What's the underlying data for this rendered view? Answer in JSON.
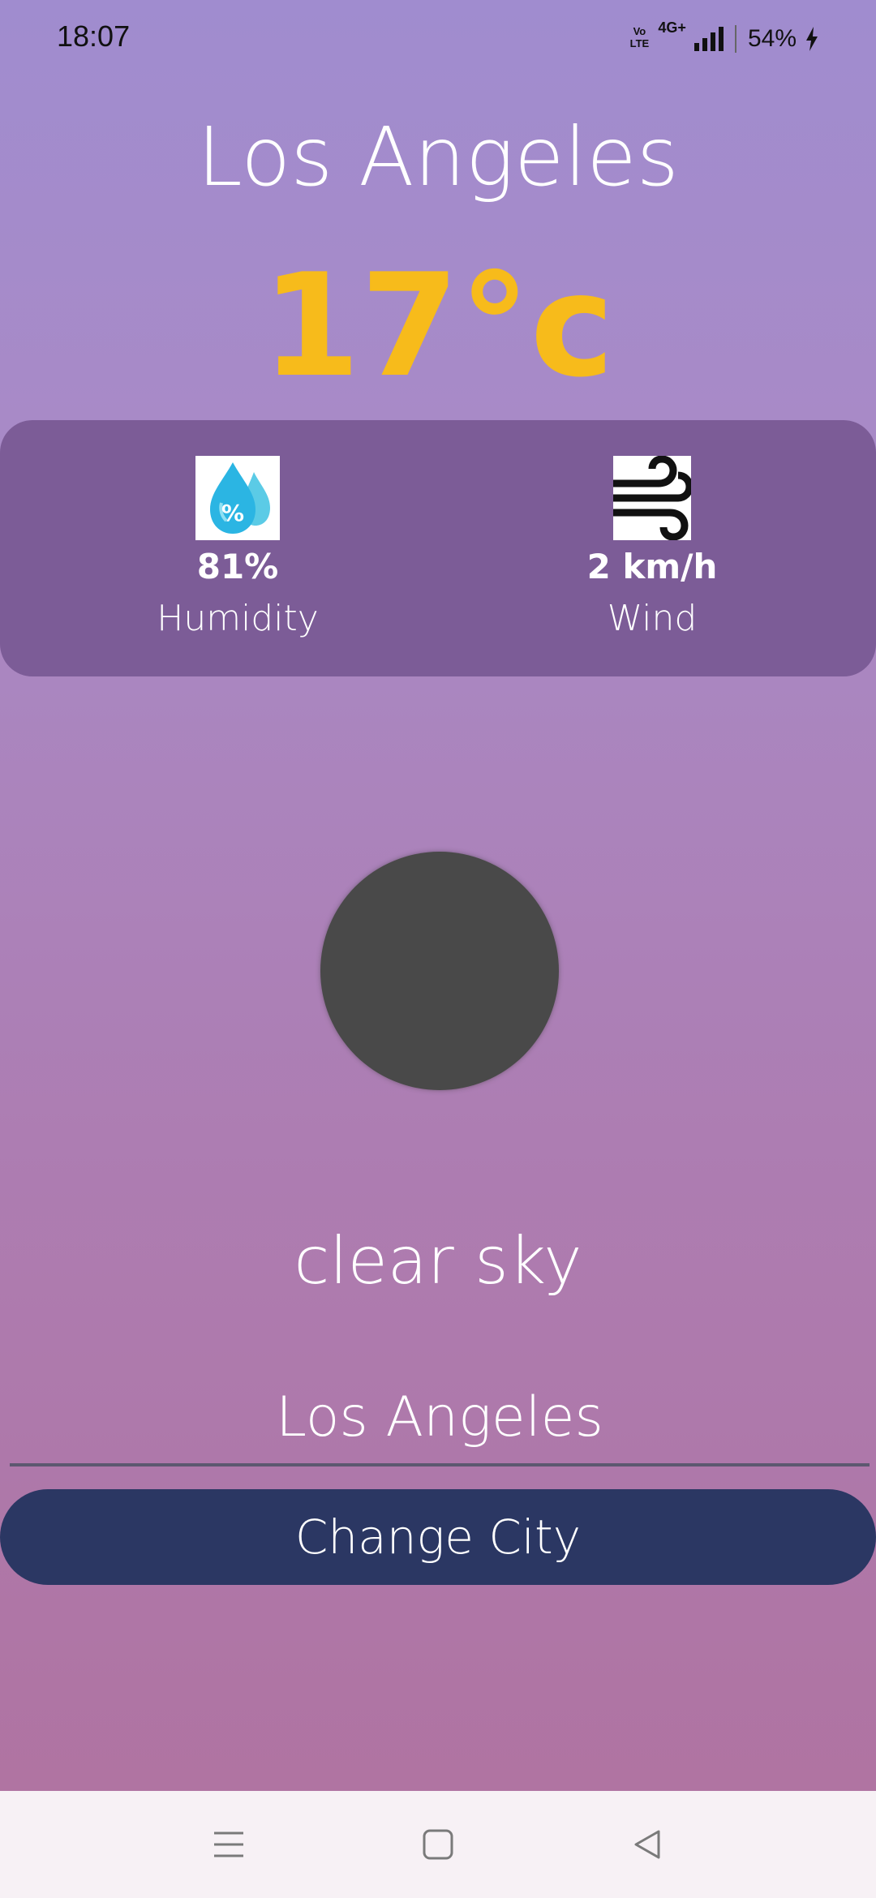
{
  "status_bar": {
    "time": "18:07",
    "network": "4G+",
    "battery": "54%"
  },
  "weather": {
    "city": "Los Angeles",
    "temperature": "17°c",
    "humidity_value": "81%",
    "humidity_label": "Humidity",
    "wind_value": "2 km/h",
    "wind_label": "Wind",
    "description": "clear sky"
  },
  "form": {
    "city_input_value": "Los Angeles",
    "button_label": "Change City"
  },
  "colors": {
    "temperature": "#f7bb1b",
    "card": "#7c5c97",
    "button": "#2b3763"
  },
  "icons": {
    "humidity": "humidity-drop-icon",
    "wind": "wind-icon",
    "weather": "weather-icon"
  }
}
